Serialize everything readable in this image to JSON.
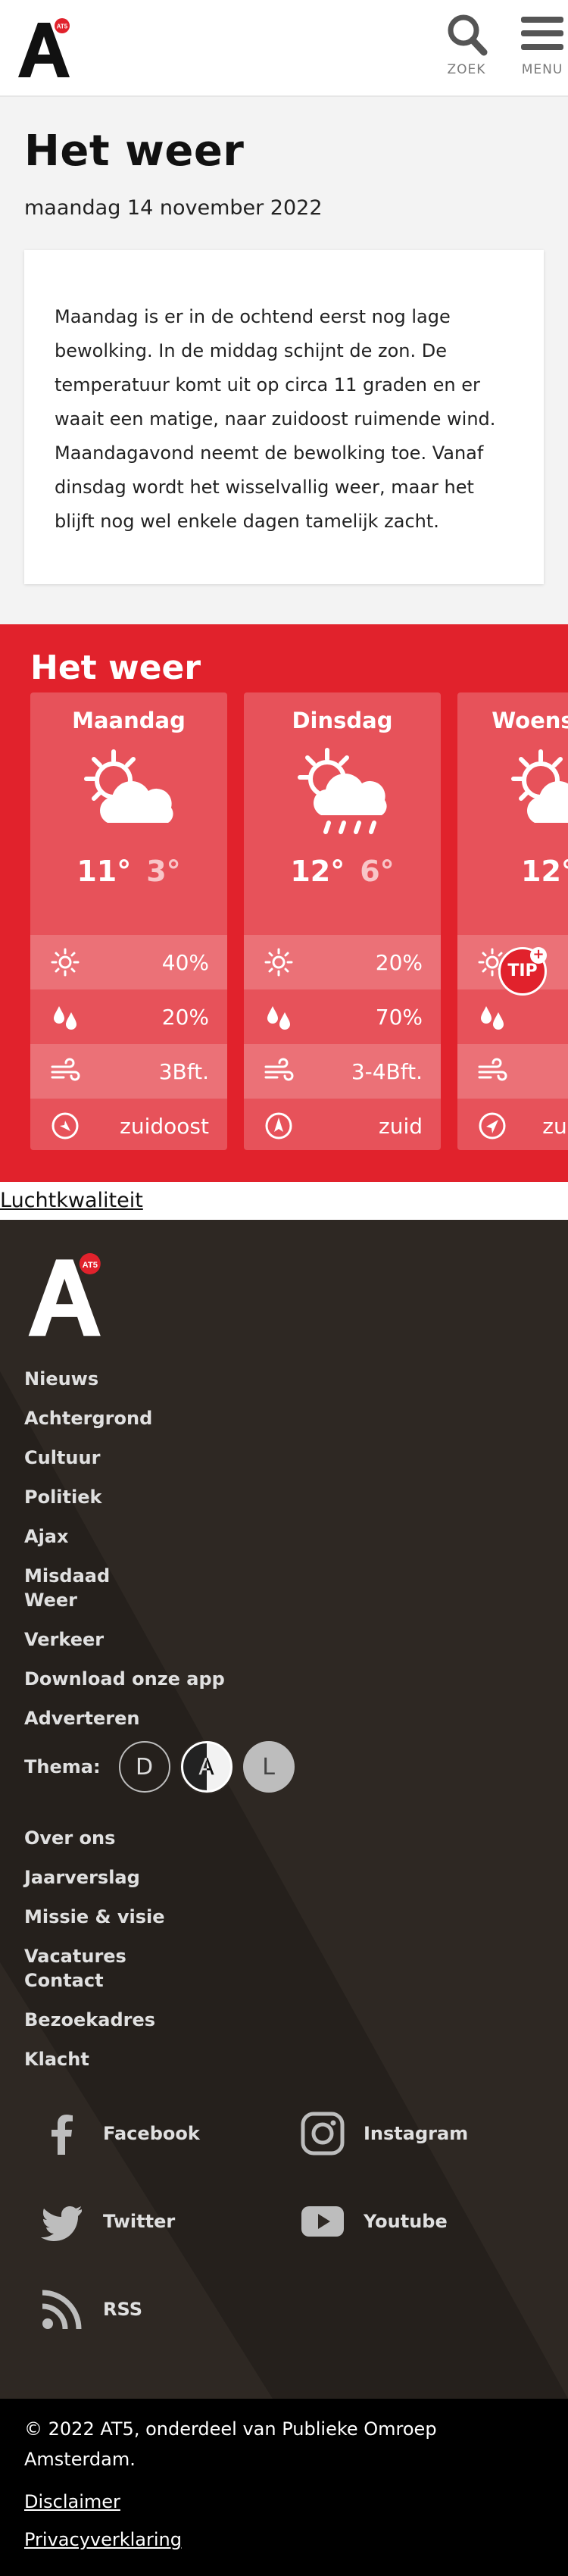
{
  "header": {
    "logo_badge": "AT5",
    "logo_letter": "A",
    "search_label": "ZOEK",
    "menu_label": "MENU"
  },
  "intro": {
    "title": "Het weer",
    "date": "maandag 14 november 2022",
    "description": "Maandag is er in de ochtend eerst nog lage bewolking. In de middag schijnt de zon. De temperatuur komt uit op circa 11 graden en er waait een matige, naar zuidoost ruimende wind. Maandagavond neemt de bewolking toe. Vanaf dinsdag wordt het wisselvallig weer, maar het blijft nog wel enkele dagen tamelijk zacht."
  },
  "forecast": {
    "title": "Het weer",
    "days": [
      {
        "name": "Maandag",
        "icon": "sun-cloud-icon",
        "max": "11°",
        "min": "3°",
        "sun": "40%",
        "rain": "20%",
        "wind": "3Bft.",
        "dir": "zuidoost"
      },
      {
        "name": "Dinsdag",
        "icon": "sun-cloud-rain-icon",
        "max": "12°",
        "min": "6°",
        "sun": "20%",
        "rain": "70%",
        "wind": "3-4Bft.",
        "dir": "zuid"
      },
      {
        "name": "Woensdag",
        "icon": "sun-cloud-icon",
        "max": "12°",
        "min": "",
        "sun": "",
        "rain": "",
        "wind": "",
        "dir": "zuidwest"
      }
    ],
    "tip_label": "TIP",
    "tip_plus": "+"
  },
  "air_quality_link": "Luchtkwaliteit",
  "footer": {
    "logo_badge": "AT5",
    "logo_letter": "A",
    "nav": [
      "Nieuws",
      "Achtergrond",
      "Cultuur",
      "Politiek",
      "Ajax",
      "Misdaad",
      "Weer",
      "Verkeer",
      "Download onze app",
      "Adverteren"
    ],
    "theme_label": "Thema:",
    "themes": [
      "D",
      "A",
      "L"
    ],
    "nav2": [
      "Over ons",
      "Jaarverslag",
      "Missie & visie",
      "Vacatures",
      "Contact",
      "Bezoekadres",
      "Klacht"
    ],
    "social": [
      "Facebook",
      "Instagram",
      "Twitter",
      "Youtube",
      "RSS"
    ]
  },
  "bottom": {
    "copyright": "© 2022 AT5, onderdeel van Publieke Omroep Amsterdam.",
    "links": [
      "Disclaimer",
      "Privacyverklaring"
    ]
  },
  "colors": {
    "brand_red": "#e1222c",
    "footer_bg": "#2e2823"
  }
}
